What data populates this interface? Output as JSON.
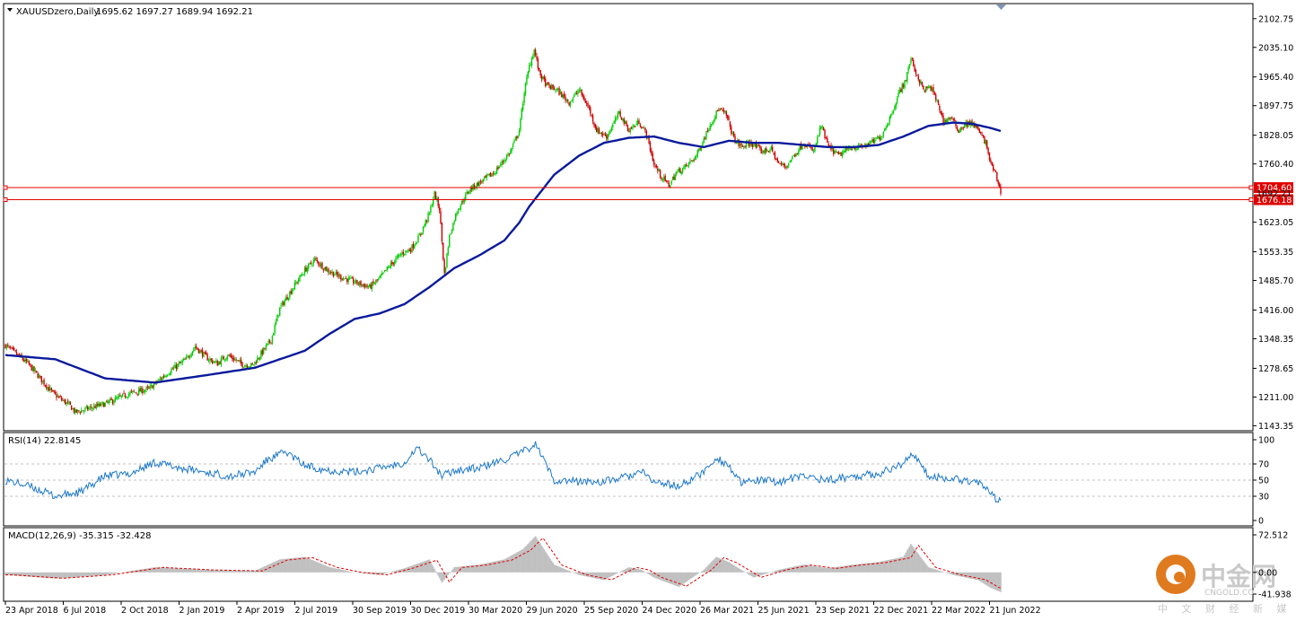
{
  "chart_data": {
    "type": "candlestick",
    "symbol_header": "XAUUSDzero,Daily",
    "ohlc_header": "1695.62 1697.27 1689.94 1692.21",
    "colors": {
      "bull": "#00cc00",
      "bear": "#cc0000",
      "moving_average": "#0a1a9c",
      "rsi": "#1e78c8",
      "macd_hist": "#c0c0c0",
      "macd_signal": "#e00000",
      "level_line": "#e00000"
    },
    "x_ticks": [
      "23 Apr 2018",
      "6 Jul 2018",
      "2 Oct 2018",
      "2 Jan 2019",
      "2 Apr 2019",
      "2 Jul 2019",
      "30 Sep 2019",
      "30 Dec 2019",
      "30 Mar 2020",
      "29 Jun 2020",
      "25 Sep 2020",
      "24 Dec 2020",
      "26 Mar 2021",
      "25 Jun 2021",
      "23 Sep 2021",
      "22 Dec 2021",
      "22 Mar 2022",
      "21 Jun 2022"
    ],
    "price_axis": {
      "ylim": [
        1140,
        2115
      ],
      "ticks": [
        "2102.75",
        "2035.10",
        "1965.40",
        "1897.75",
        "1828.05",
        "1760.40",
        "1623.05",
        "1553.35",
        "1485.70",
        "1416.00",
        "1348.35",
        "1278.65",
        "1211.00",
        "1143.35"
      ]
    },
    "horizontal_levels": [
      {
        "label": "1704.60",
        "value": 1704.6
      },
      {
        "label": "1676.18",
        "value": 1676.18
      }
    ],
    "hidden_tag": "1692.21",
    "price_keypoints": [
      [
        0,
        1333
      ],
      [
        18,
        1290
      ],
      [
        38,
        1220
      ],
      [
        52,
        1190
      ],
      [
        56,
        1175
      ],
      [
        80,
        1195
      ],
      [
        100,
        1220
      ],
      [
        115,
        1230
      ],
      [
        130,
        1268
      ],
      [
        145,
        1300
      ],
      [
        152,
        1330
      ],
      [
        163,
        1300
      ],
      [
        170,
        1290
      ],
      [
        178,
        1310
      ],
      [
        190,
        1288
      ],
      [
        198,
        1285
      ],
      [
        213,
        1345
      ],
      [
        220,
        1420
      ],
      [
        232,
        1475
      ],
      [
        240,
        1510
      ],
      [
        248,
        1535
      ],
      [
        258,
        1510
      ],
      [
        268,
        1495
      ],
      [
        282,
        1480
      ],
      [
        292,
        1470
      ],
      [
        300,
        1490
      ],
      [
        308,
        1520
      ],
      [
        318,
        1550
      ],
      [
        325,
        1560
      ],
      [
        332,
        1590
      ],
      [
        340,
        1645
      ],
      [
        344,
        1690
      ],
      [
        348,
        1655
      ],
      [
        352,
        1500
      ],
      [
        356,
        1590
      ],
      [
        362,
        1650
      ],
      [
        372,
        1700
      ],
      [
        382,
        1720
      ],
      [
        392,
        1740
      ],
      [
        405,
        1790
      ],
      [
        412,
        1840
      ],
      [
        416,
        1930
      ],
      [
        420,
        1990
      ],
      [
        424,
        2030
      ],
      [
        428,
        1975
      ],
      [
        434,
        1945
      ],
      [
        442,
        1935
      ],
      [
        452,
        1905
      ],
      [
        460,
        1935
      ],
      [
        468,
        1890
      ],
      [
        474,
        1840
      ],
      [
        482,
        1825
      ],
      [
        492,
        1880
      ],
      [
        500,
        1840
      ],
      [
        508,
        1860
      ],
      [
        514,
        1830
      ],
      [
        520,
        1760
      ],
      [
        526,
        1730
      ],
      [
        532,
        1710
      ],
      [
        538,
        1740
      ],
      [
        546,
        1755
      ],
      [
        554,
        1780
      ],
      [
        560,
        1820
      ],
      [
        566,
        1860
      ],
      [
        572,
        1890
      ],
      [
        578,
        1875
      ],
      [
        584,
        1820
      ],
      [
        590,
        1800
      ],
      [
        598,
        1810
      ],
      [
        606,
        1790
      ],
      [
        614,
        1795
      ],
      [
        620,
        1760
      ],
      [
        626,
        1755
      ],
      [
        632,
        1780
      ],
      [
        640,
        1810
      ],
      [
        648,
        1790
      ],
      [
        654,
        1850
      ],
      [
        660,
        1800
      ],
      [
        668,
        1780
      ],
      [
        678,
        1800
      ],
      [
        686,
        1800
      ],
      [
        694,
        1810
      ],
      [
        702,
        1825
      ],
      [
        710,
        1875
      ],
      [
        716,
        1925
      ],
      [
        722,
        1960
      ],
      [
        726,
        2010
      ],
      [
        730,
        1975
      ],
      [
        736,
        1935
      ],
      [
        742,
        1940
      ],
      [
        748,
        1900
      ],
      [
        752,
        1860
      ],
      [
        758,
        1870
      ],
      [
        764,
        1840
      ],
      [
        770,
        1855
      ],
      [
        776,
        1855
      ],
      [
        782,
        1830
      ],
      [
        786,
        1810
      ],
      [
        790,
        1760
      ],
      [
        794,
        1735
      ],
      [
        796,
        1715
      ],
      [
        798,
        1692
      ]
    ],
    "ma_keypoints": [
      [
        0,
        1310
      ],
      [
        40,
        1300
      ],
      [
        80,
        1255
      ],
      [
        120,
        1245
      ],
      [
        160,
        1262
      ],
      [
        200,
        1280
      ],
      [
        240,
        1320
      ],
      [
        260,
        1360
      ],
      [
        280,
        1395
      ],
      [
        300,
        1408
      ],
      [
        320,
        1430
      ],
      [
        340,
        1470
      ],
      [
        360,
        1515
      ],
      [
        380,
        1545
      ],
      [
        400,
        1580
      ],
      [
        412,
        1622
      ],
      [
        420,
        1660
      ],
      [
        440,
        1735
      ],
      [
        460,
        1780
      ],
      [
        480,
        1810
      ],
      [
        500,
        1822
      ],
      [
        520,
        1825
      ],
      [
        540,
        1810
      ],
      [
        560,
        1800
      ],
      [
        580,
        1815
      ],
      [
        600,
        1810
      ],
      [
        620,
        1810
      ],
      [
        640,
        1805
      ],
      [
        660,
        1800
      ],
      [
        680,
        1800
      ],
      [
        700,
        1805
      ],
      [
        720,
        1825
      ],
      [
        740,
        1850
      ],
      [
        760,
        1858
      ],
      [
        775,
        1855
      ],
      [
        790,
        1845
      ],
      [
        798,
        1838
      ]
    ],
    "rsi": {
      "label": "RSI(14) 22.8145",
      "ylim": [
        0,
        100
      ],
      "ticks": [
        "100",
        "70",
        "50",
        "30",
        "0"
      ],
      "keypoints": [
        [
          0,
          50
        ],
        [
          20,
          42
        ],
        [
          40,
          30
        ],
        [
          60,
          35
        ],
        [
          80,
          55
        ],
        [
          100,
          58
        ],
        [
          120,
          72
        ],
        [
          140,
          65
        ],
        [
          160,
          60
        ],
        [
          180,
          55
        ],
        [
          200,
          60
        ],
        [
          210,
          75
        ],
        [
          225,
          85
        ],
        [
          240,
          68
        ],
        [
          260,
          62
        ],
        [
          280,
          60
        ],
        [
          300,
          65
        ],
        [
          320,
          72
        ],
        [
          330,
          90
        ],
        [
          340,
          75
        ],
        [
          350,
          55
        ],
        [
          360,
          62
        ],
        [
          380,
          65
        ],
        [
          400,
          75
        ],
        [
          415,
          85
        ],
        [
          425,
          95
        ],
        [
          440,
          50
        ],
        [
          460,
          48
        ],
        [
          480,
          48
        ],
        [
          500,
          55
        ],
        [
          510,
          60
        ],
        [
          520,
          48
        ],
        [
          540,
          42
        ],
        [
          560,
          60
        ],
        [
          570,
          78
        ],
        [
          580,
          68
        ],
        [
          590,
          45
        ],
        [
          600,
          50
        ],
        [
          620,
          48
        ],
        [
          640,
          55
        ],
        [
          660,
          50
        ],
        [
          680,
          55
        ],
        [
          700,
          58
        ],
        [
          720,
          70
        ],
        [
          726,
          85
        ],
        [
          740,
          55
        ],
        [
          760,
          52
        ],
        [
          780,
          48
        ],
        [
          790,
          32
        ],
        [
          798,
          23
        ]
      ]
    },
    "macd": {
      "label": "MACD(12,26,9) -35.315 -32.428",
      "ticks": [
        "72.512",
        "0.00",
        "-41.938"
      ],
      "ylim": [
        -41.938,
        72.512
      ],
      "keypoints": [
        [
          0,
          -5
        ],
        [
          40,
          -12
        ],
        [
          80,
          -5
        ],
        [
          120,
          10
        ],
        [
          160,
          5
        ],
        [
          200,
          3
        ],
        [
          220,
          25
        ],
        [
          240,
          30
        ],
        [
          260,
          10
        ],
        [
          280,
          0
        ],
        [
          300,
          -5
        ],
        [
          320,
          8
        ],
        [
          340,
          25
        ],
        [
          350,
          -20
        ],
        [
          360,
          10
        ],
        [
          380,
          15
        ],
        [
          400,
          25
        ],
        [
          415,
          45
        ],
        [
          425,
          70
        ],
        [
          440,
          15
        ],
        [
          460,
          -5
        ],
        [
          480,
          -15
        ],
        [
          500,
          10
        ],
        [
          510,
          5
        ],
        [
          520,
          -10
        ],
        [
          540,
          -28
        ],
        [
          560,
          5
        ],
        [
          570,
          30
        ],
        [
          580,
          20
        ],
        [
          600,
          -10
        ],
        [
          620,
          5
        ],
        [
          640,
          15
        ],
        [
          660,
          8
        ],
        [
          680,
          15
        ],
        [
          700,
          20
        ],
        [
          720,
          30
        ],
        [
          726,
          55
        ],
        [
          740,
          10
        ],
        [
          760,
          -5
        ],
        [
          780,
          -15
        ],
        [
          790,
          -30
        ],
        [
          798,
          -38
        ]
      ]
    },
    "watermark": {
      "title": "中金网",
      "subtitle": "中 文 财 经 新 媒 体",
      "url": "CNGOLD.CO"
    }
  }
}
